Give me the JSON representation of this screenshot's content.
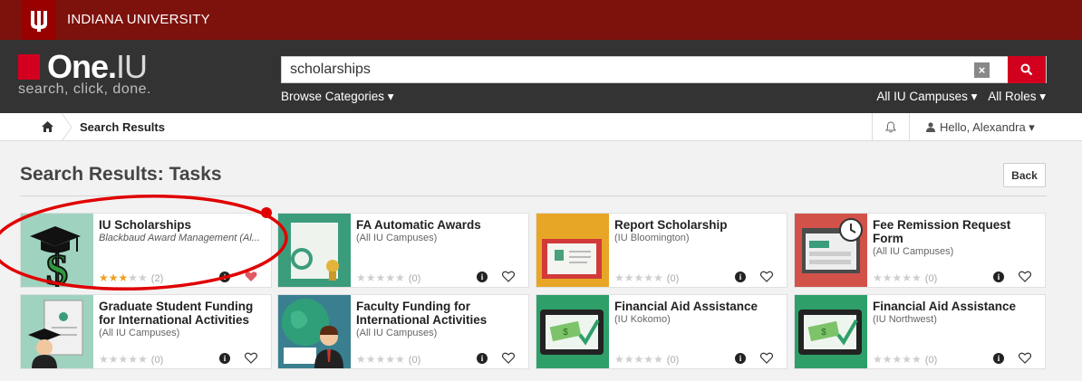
{
  "university": {
    "name": "INDIANA UNIVERSITY"
  },
  "logo": {
    "one": "One.",
    "iu": "IU",
    "tagline": "search, click, done."
  },
  "search": {
    "value": "scholarships",
    "clear": "×"
  },
  "nav": {
    "browse": "Browse Categories ▾",
    "campuses": "All IU Campuses ▾",
    "roles": "All Roles ▾"
  },
  "breadcrumb": {
    "label": "Search Results"
  },
  "user": {
    "greeting": "Hello, Alexandra ▾"
  },
  "main": {
    "heading": "Search Results: Tasks",
    "back": "Back"
  },
  "cards": [
    {
      "title": "IU Scholarships",
      "subtitle": "Blackbaud Award Management (Al...",
      "rating": 3,
      "count": "(2)",
      "favorited": true
    },
    {
      "title": "FA Automatic Awards",
      "subtitle": "(All IU Campuses)",
      "rating": 0,
      "count": "(0)",
      "favorited": false
    },
    {
      "title": "Report Scholarship",
      "subtitle": "(IU Bloomington)",
      "rating": 0,
      "count": "(0)",
      "favorited": false
    },
    {
      "title": "Fee Remission Request Form",
      "subtitle": "(All IU Campuses)",
      "rating": 0,
      "count": "(0)",
      "favorited": false
    },
    {
      "title": "Graduate Student Funding for International Activities",
      "subtitle": "(All IU Campuses)",
      "rating": 0,
      "count": "(0)",
      "favorited": false
    },
    {
      "title": "Faculty Funding for International Activities",
      "subtitle": "(All IU Campuses)",
      "rating": 0,
      "count": "(0)",
      "favorited": false
    },
    {
      "title": "Financial Aid Assistance",
      "subtitle": "(IU Kokomo)",
      "rating": 0,
      "count": "(0)",
      "favorited": false
    },
    {
      "title": "Financial Aid Assistance",
      "subtitle": "(IU Northwest)",
      "rating": 0,
      "count": "(0)",
      "favorited": false
    }
  ],
  "colors": {
    "crimson": "#7d110c",
    "accent": "#d2001e",
    "star": "#f0a024",
    "annotation": "#e00000"
  },
  "icons": [
    "trident-icon",
    "search-icon",
    "home-icon",
    "bell-icon",
    "user-icon",
    "info-icon",
    "heart-icon"
  ]
}
